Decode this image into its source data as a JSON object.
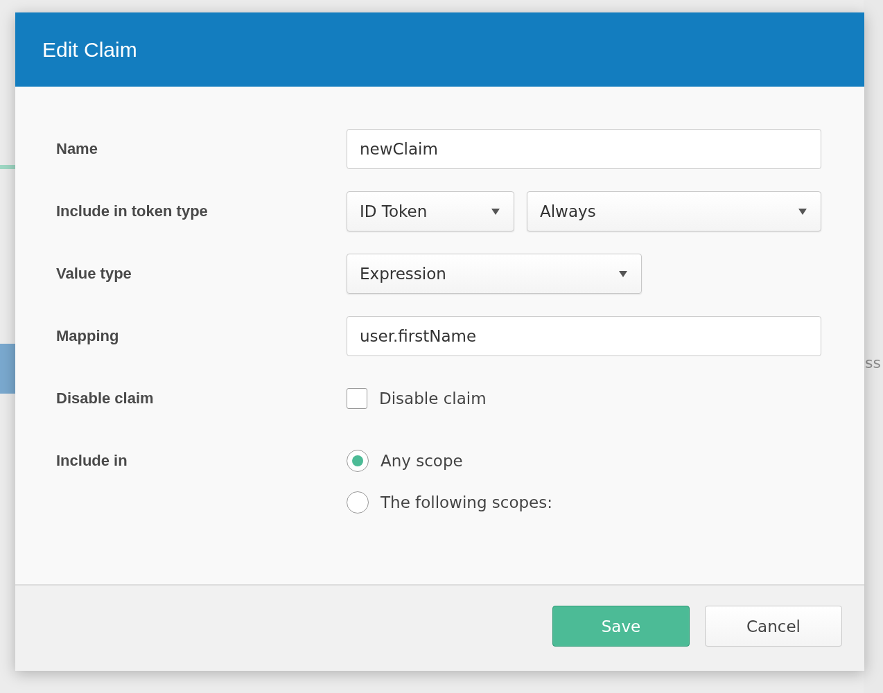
{
  "background": {
    "side_text": "ss"
  },
  "dialog": {
    "title": "Edit Claim"
  },
  "fields": [
    {
      "kind": "text",
      "label": "Name",
      "value": "newClaim"
    },
    {
      "kind": "selects",
      "label": "Include in token type",
      "selects": [
        {
          "value": "ID Token"
        },
        {
          "value": "Always"
        }
      ]
    },
    {
      "kind": "selects",
      "label": "Value type",
      "selects": [
        {
          "value": "Expression"
        }
      ]
    },
    {
      "kind": "text",
      "label": "Mapping",
      "value": "user.firstName"
    },
    {
      "kind": "checkbox",
      "label": "Disable claim",
      "option": "Disable claim",
      "checked": false
    },
    {
      "kind": "radios",
      "label": "Include in",
      "options": [
        {
          "label": "Any scope",
          "selected": true
        },
        {
          "label": "The following scopes:",
          "selected": false
        }
      ]
    }
  ],
  "buttons": [
    {
      "label": "Save",
      "kind": "primary"
    },
    {
      "label": "Cancel",
      "kind": "secondary"
    }
  ]
}
